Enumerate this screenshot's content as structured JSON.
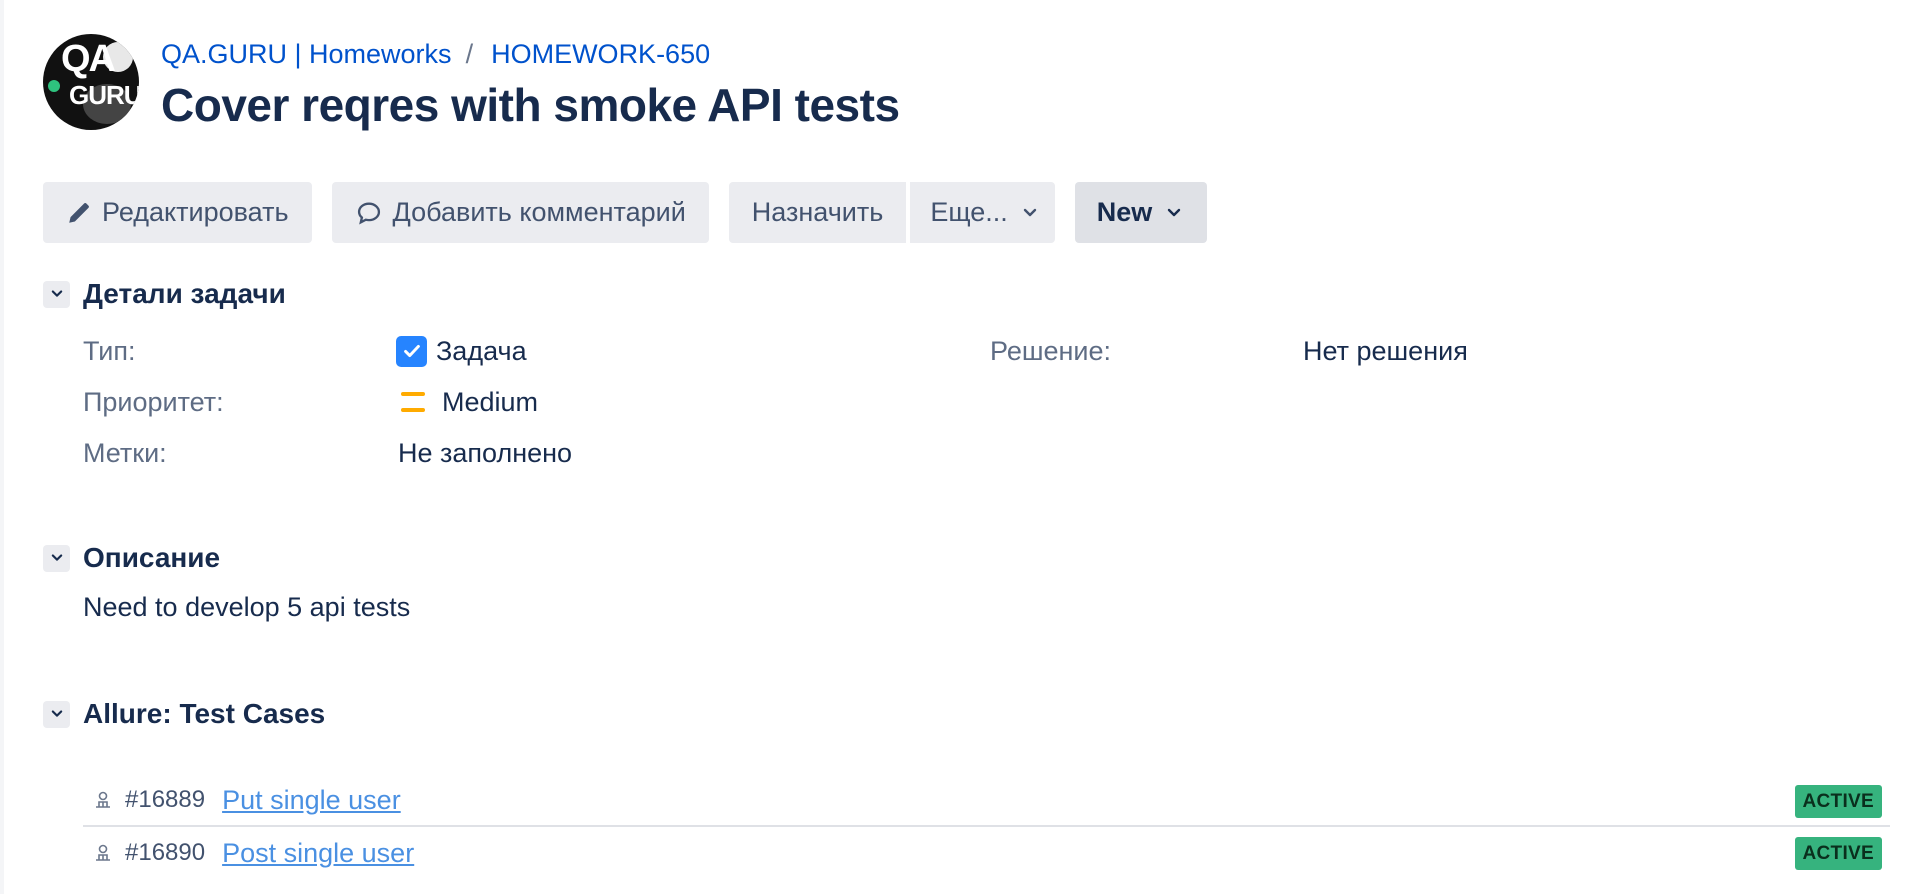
{
  "header": {
    "project_link": "QA.GURU | Homeworks",
    "separator": "/",
    "issue_key": "HOMEWORK-650",
    "title": "Cover reqres with smoke API tests",
    "avatar": {
      "line1": "QA",
      "line2": "GURU"
    }
  },
  "toolbar": {
    "edit_label": "Редактировать",
    "comment_label": "Добавить комментарий",
    "assign_label": "Назначить",
    "more_label": "Еще...",
    "status_label": "New"
  },
  "details": {
    "section_title": "Детали задачи",
    "type_label": "Тип:",
    "type_value": "Задача",
    "priority_label": "Приоритет:",
    "priority_value": "Medium",
    "labels_label": "Метки:",
    "labels_value": "Не заполнено",
    "resolution_label": "Решение:",
    "resolution_value": "Нет решения"
  },
  "description": {
    "section_title": "Описание",
    "text": "Need to develop 5 api tests"
  },
  "allure": {
    "section_title": "Allure: Test Cases",
    "cases": [
      {
        "id": "#16889",
        "name": "Put single user",
        "status": "ACTIVE"
      },
      {
        "id": "#16890",
        "name": "Post single user",
        "status": "ACTIVE"
      }
    ]
  },
  "colors": {
    "link": "#0052cc",
    "title": "#172b4d",
    "button_bg": "#ebecf0",
    "priority_medium": "#ffab00",
    "checkbox": "#2684ff",
    "badge_active": "#36b37e"
  },
  "icons": [
    "pencil-icon",
    "comment-icon",
    "chevron-down-icon",
    "checkbox-icon",
    "priority-medium-icon",
    "test-case-icon"
  ]
}
